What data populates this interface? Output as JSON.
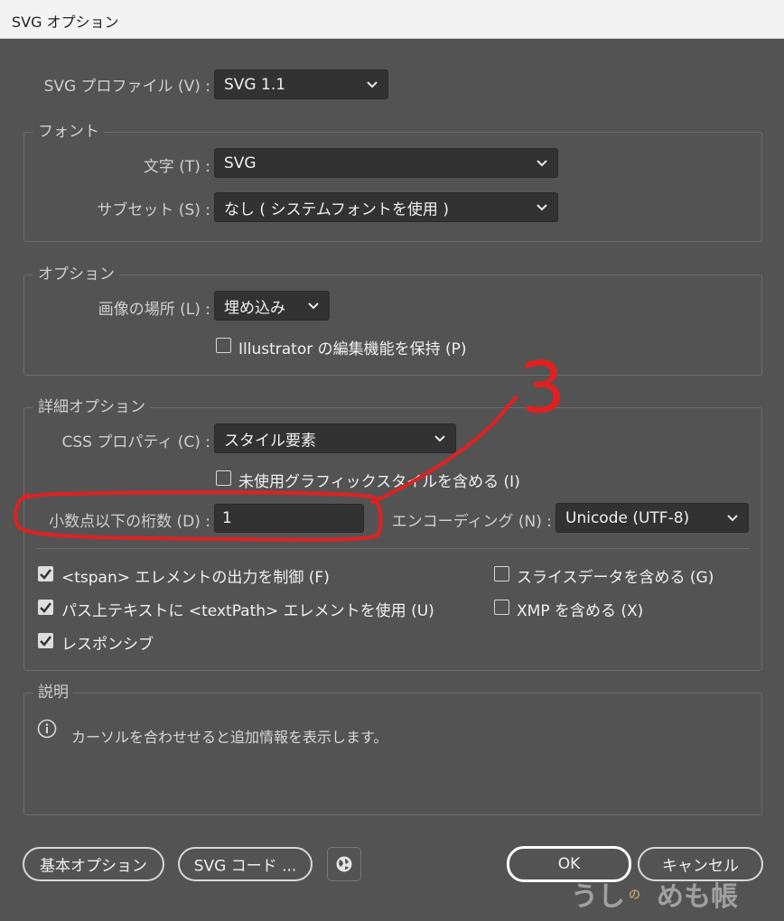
{
  "window": {
    "title": "SVG オプション"
  },
  "profile": {
    "label": "SVG プロファイル (V) :",
    "value": "SVG 1.1"
  },
  "font_group": {
    "legend": "フォント",
    "type_label": "文字 (T) :",
    "type_value": "SVG",
    "subset_label": "サブセット (S) :",
    "subset_value": "なし ( システムフォントを使用 )"
  },
  "options_group": {
    "legend": "オプション",
    "image_label": "画像の場所 (L) :",
    "image_value": "埋め込み",
    "preserve_label": "Illustrator の編集機能を保持 (P)",
    "preserve_checked": false
  },
  "advanced_group": {
    "legend": "詳細オプション",
    "css_label": "CSS プロパティ (C) :",
    "css_value": "スタイル要素",
    "unused_label": "未使用グラフィックスタイルを含める (I)",
    "unused_checked": false,
    "decimal_label": "小数点以下の桁数 (D) :",
    "decimal_value": "1",
    "encoding_label": "エンコーディング (N) :",
    "encoding_value": "Unicode (UTF-8)",
    "tspan_label": "<tspan> エレメントの出力を制御 (F)",
    "tspan_checked": true,
    "textpath_label": "パス上テキストに <textPath> エレメントを使用 (U)",
    "textpath_checked": true,
    "responsive_label": "レスポンシブ",
    "responsive_checked": true,
    "slice_label": "スライスデータを含める (G)",
    "slice_checked": false,
    "xmp_label": "XMP を含める (X)",
    "xmp_checked": false
  },
  "description_group": {
    "legend": "説明",
    "text": "カーソルを合わせせると追加情報を表示します。"
  },
  "buttons": {
    "basic": "基本オプション",
    "svg_code": "SVG コード ...",
    "ok": "OK",
    "cancel": "キャンセル"
  },
  "annotation": {
    "number": "3",
    "color": "#e02020"
  },
  "watermark": {
    "part1": "うし",
    "part2": "の",
    "part3": "めも帳"
  },
  "colors": {
    "background": "#535353",
    "field": "#323232",
    "titlebar": "#f3f3f3"
  }
}
